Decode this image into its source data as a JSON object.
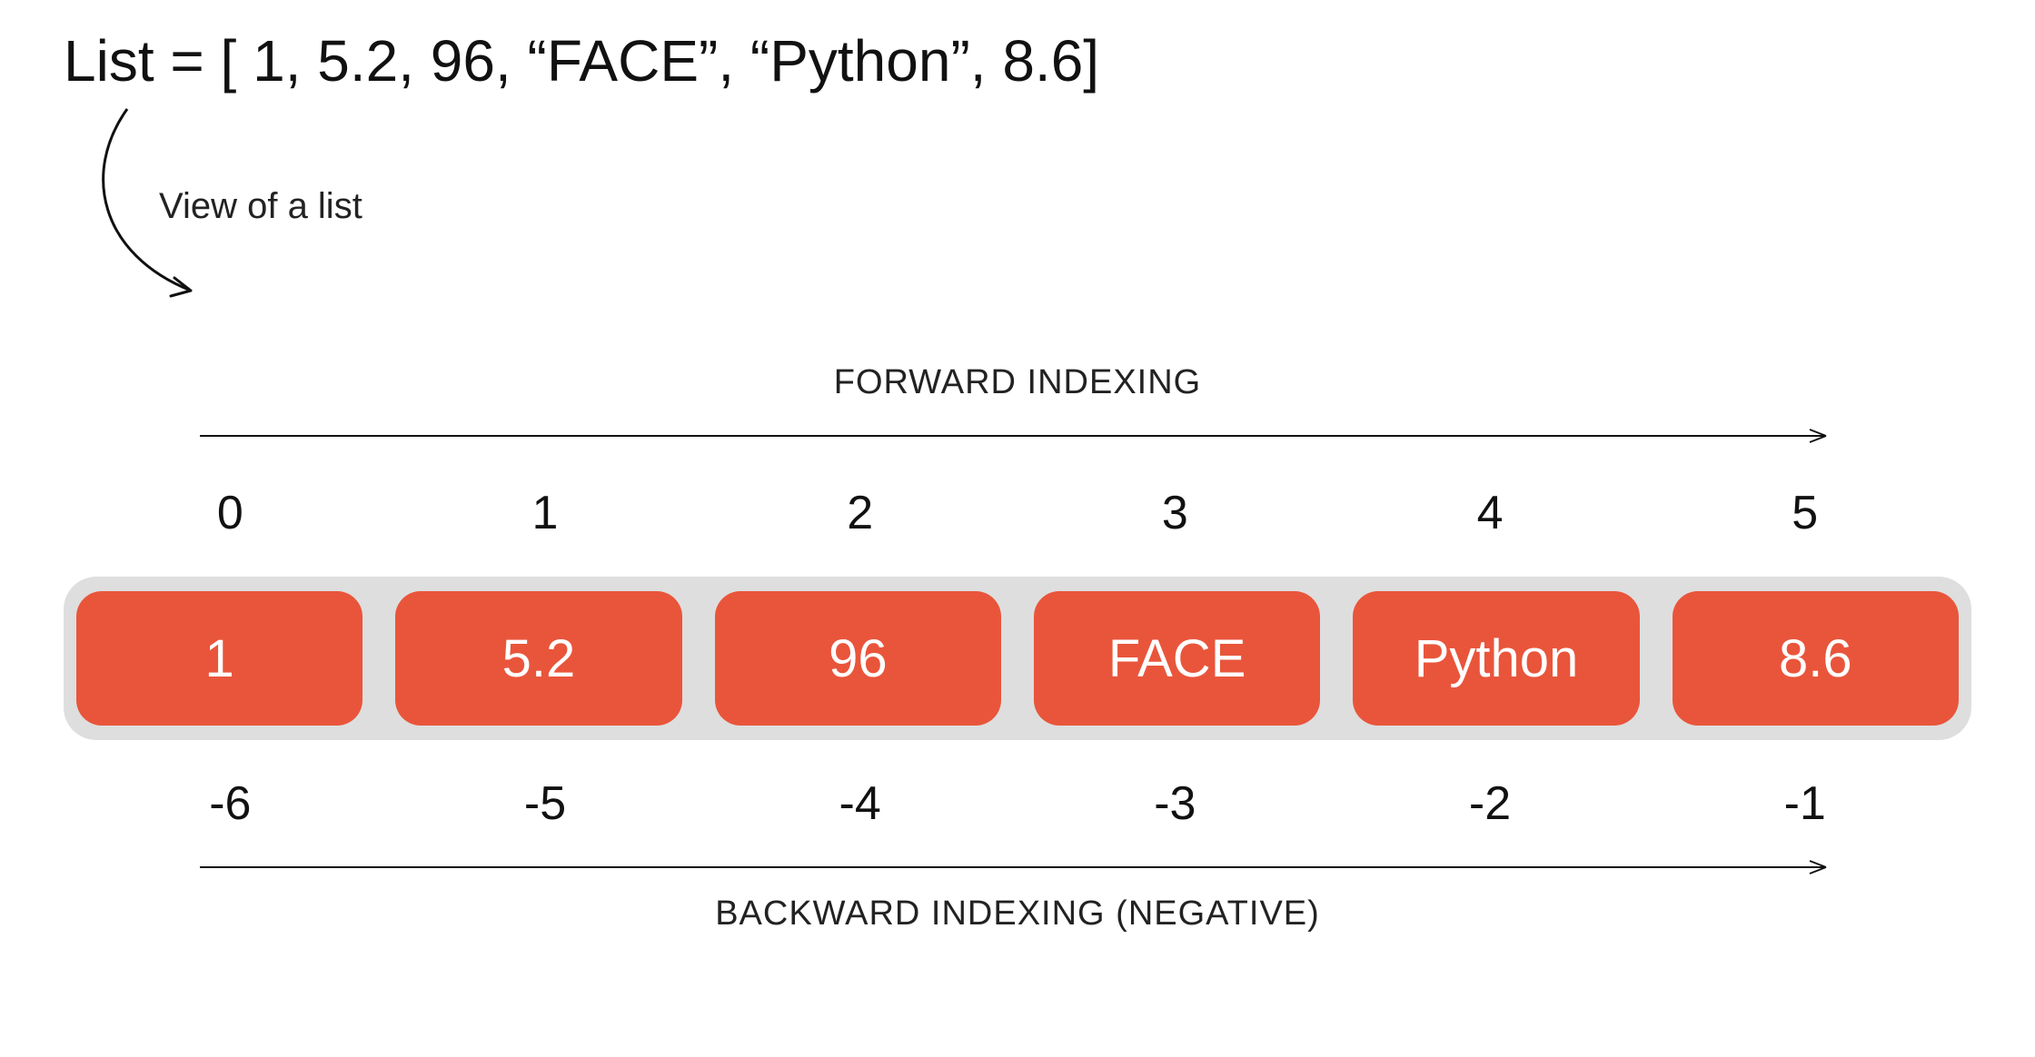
{
  "title": "List = [ 1, 5.2, 96, “FACE”, “Python”, 8.6]",
  "view_caption": "View of a list",
  "forward_label": "FORWARD INDEXING",
  "backward_label": "BACKWARD INDEXING (NEGATIVE)",
  "forward_indices": [
    "0",
    "1",
    "2",
    "3",
    "4",
    "5"
  ],
  "backward_indices": [
    "-6",
    "-5",
    "-4",
    "-3",
    "-2",
    "-1"
  ],
  "cells": [
    "1",
    "5.2",
    "96",
    "FACE",
    "Python",
    "8.6"
  ],
  "colors": {
    "cell_bg": "#e9553b",
    "container_bg": "#dedede",
    "text": "#111111",
    "cell_text": "#ffffff"
  },
  "chart_data": {
    "type": "table",
    "title": "Python list indexing (forward and backward)",
    "columns": [
      "forward_index",
      "value",
      "backward_index"
    ],
    "rows": [
      {
        "forward_index": 0,
        "value": 1,
        "backward_index": -6
      },
      {
        "forward_index": 1,
        "value": 5.2,
        "backward_index": -5
      },
      {
        "forward_index": 2,
        "value": 96,
        "backward_index": -4
      },
      {
        "forward_index": 3,
        "value": "FACE",
        "backward_index": -3
      },
      {
        "forward_index": 4,
        "value": "Python",
        "backward_index": -2
      },
      {
        "forward_index": 5,
        "value": 8.6,
        "backward_index": -1
      }
    ]
  }
}
